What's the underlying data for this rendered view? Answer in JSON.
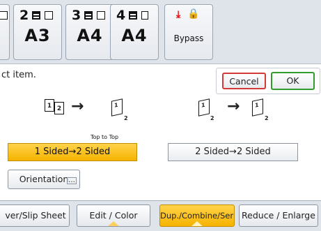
{
  "trays": [
    {
      "num": "",
      "size": ""
    },
    {
      "num": "2",
      "size": "A3"
    },
    {
      "num": "3",
      "size": "A4"
    },
    {
      "num": "4",
      "size": "A4"
    }
  ],
  "bypass": {
    "label": "Bypass"
  },
  "message": "ct item.",
  "actions": {
    "cancel": "Cancel",
    "ok": "OK"
  },
  "diagram": {
    "left_sheets": [
      "1",
      "2"
    ],
    "right_sheet_page": "1",
    "right_sub": "2",
    "top_to_top": "Top to Top"
  },
  "options": {
    "one_to_two": "1 Sided→2 Sided",
    "two_to_two": "2 Sided→2 Sided",
    "orientation": "Orientation",
    "selected": "one_to_two"
  },
  "tabs": [
    {
      "label": "ver/Slip Sheet",
      "selected": false
    },
    {
      "label": "Edit / Color",
      "selected": false
    },
    {
      "label": "Dup./Combine/Series",
      "selected": true
    },
    {
      "label": "Reduce / Enlarge",
      "selected": false
    }
  ],
  "colors": {
    "selected": "#f5b300",
    "cancel_border": "#d23a3a",
    "ok_border": "#2f9b2f",
    "bypass_arrow": "#e00000"
  }
}
